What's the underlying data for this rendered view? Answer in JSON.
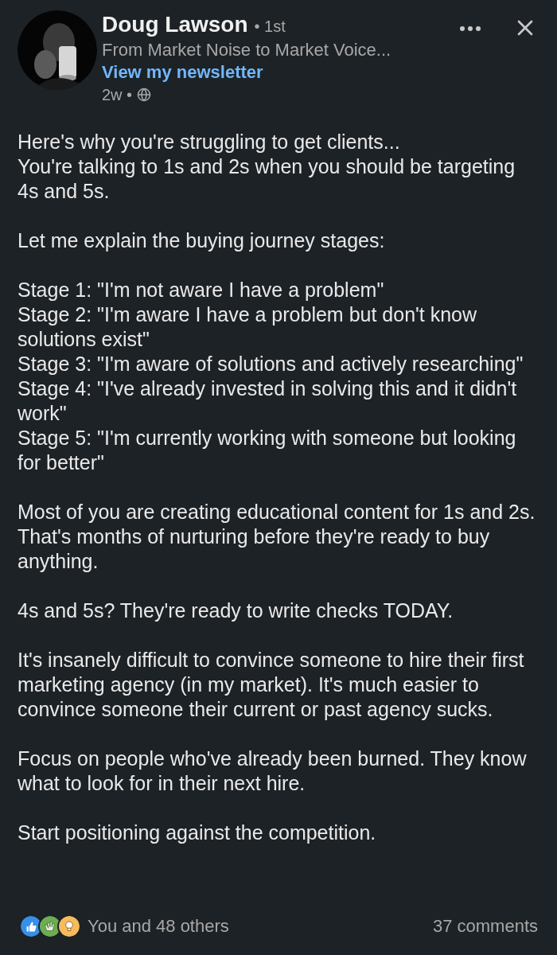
{
  "author": {
    "name": "Doug Lawson",
    "degree": "• 1st",
    "headline": "From Market Noise to Market Voice...",
    "newsletter_link": "View my newsletter",
    "age": "2w •"
  },
  "post": {
    "paragraphs": [
      [
        "Here's why you're struggling to get clients...",
        "You're talking to 1s and 2s when you should be targeting 4s and 5s."
      ],
      [
        "Let me explain the buying journey stages:"
      ],
      [
        "Stage 1: \"I'm not aware I have a problem\"",
        "Stage 2: \"I'm aware I have a problem but don't know solutions exist\"",
        "Stage 3: \"I'm aware of solutions and actively researching\"",
        "Stage 4: \"I've already invested in solving this and it didn't work\"",
        "Stage 5: \"I'm currently working with someone but looking for better\""
      ],
      [
        "Most of you are creating educational content for 1s and 2s. That's months of nurturing before they're ready to buy anything."
      ],
      [
        "4s and 5s? They're ready to write checks TODAY."
      ],
      [
        "It's insanely difficult to convince someone to hire their first marketing agency (in my market). It's much easier to convince someone their current or past agency sucks."
      ],
      [
        "Focus on people who've already been burned. They know what to look for in their next hire."
      ],
      [
        "Start positioning against the competition."
      ]
    ]
  },
  "footer": {
    "reactions": [
      {
        "kind": "like",
        "color": "#378fe9"
      },
      {
        "kind": "celebrate",
        "color": "#6dae4f"
      },
      {
        "kind": "insightful",
        "color": "#f5bb5c"
      }
    ],
    "reactions_text": "You and 48 others",
    "comments": "37 comments"
  }
}
